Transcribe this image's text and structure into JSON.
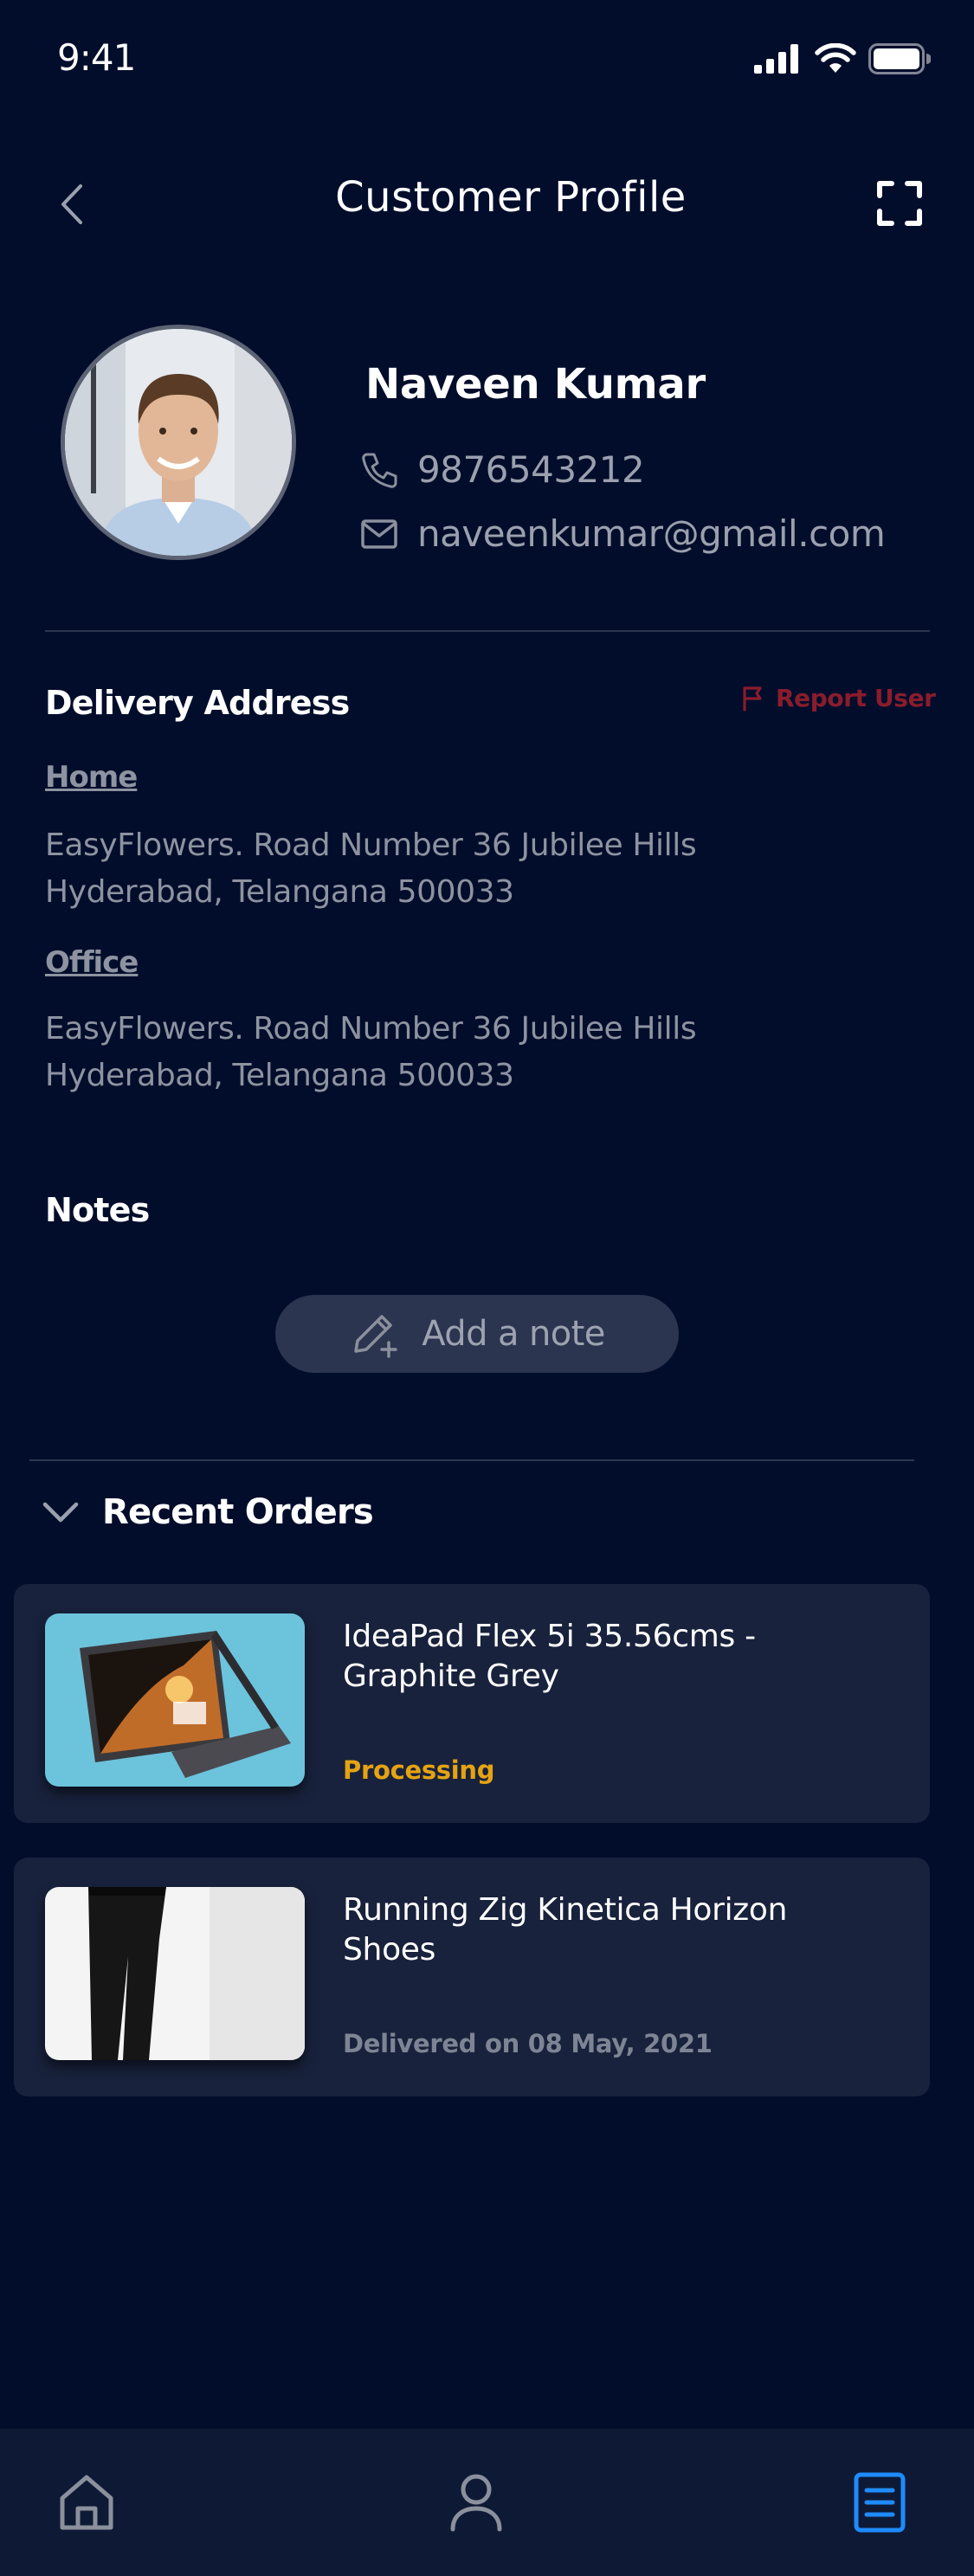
{
  "status_bar": {
    "time": "9:41",
    "icons": [
      "signal-icon",
      "wifi-icon",
      "battery-icon"
    ]
  },
  "header": {
    "title": "Customer Profile",
    "back_icon": "chevron-left-icon",
    "expand_icon": "expand-icon"
  },
  "profile": {
    "name": "Naveen Kumar",
    "phone": "9876543212",
    "email": "naveenkumar@gmail.com",
    "phone_icon": "phone-icon",
    "email_icon": "mail-icon"
  },
  "delivery": {
    "title": "Delivery Address",
    "report_label": "Report User",
    "addresses": [
      {
        "label": "Home",
        "line1": "EasyFlowers. Road Number 36 Jubilee Hills",
        "line2": "Hyderabad, Telangana 500033"
      },
      {
        "label": "Office",
        "line1": "EasyFlowers. Road Number 36 Jubilee Hills",
        "line2": "Hyderabad, Telangana 500033"
      }
    ]
  },
  "notes": {
    "title": "Notes",
    "add_label": "Add a note"
  },
  "orders": {
    "title": "Recent Orders",
    "items": [
      {
        "name": "IdeaPad Flex 5i 35.56cms - Graphite Grey",
        "status": "Processing",
        "status_color": "#e5a313"
      },
      {
        "name": "Running Zig Kinetica Horizon Shoes",
        "status": "Delivered on 08 May, 2021",
        "status_color": "#7d8494"
      }
    ]
  },
  "bottom_nav": {
    "items": [
      "home-icon",
      "user-icon",
      "orders-icon"
    ],
    "active": "orders-icon",
    "active_color": "#1e8bff",
    "inactive_color": "#8a909c"
  },
  "colors": {
    "background": "#020d2b",
    "card": "#18223c",
    "report": "#8a1c2c",
    "muted_text": "#8d93a0"
  }
}
